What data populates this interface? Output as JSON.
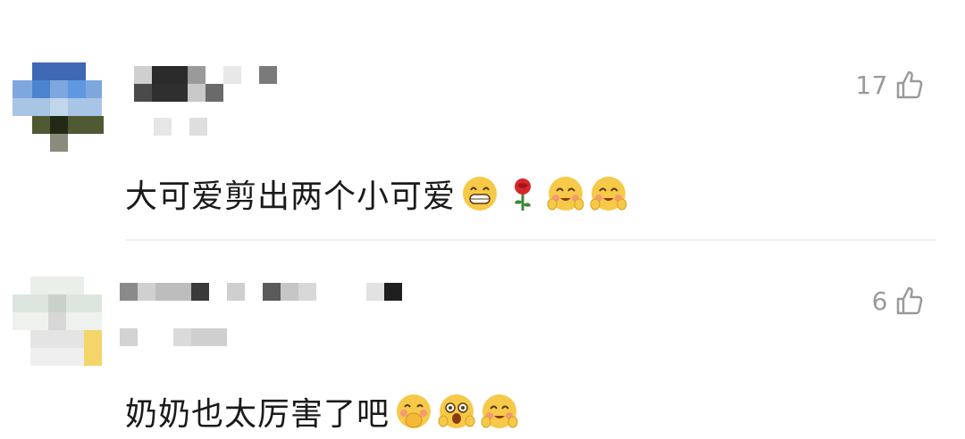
{
  "comments": [
    {
      "likes": "17",
      "text": "大可爱剪出两个小可爱",
      "emojis": [
        "grin-emoji-icon",
        "rose-emoji-icon",
        "happy-emoji-icon",
        "happy-emoji-icon"
      ]
    },
    {
      "likes": "6",
      "text": "奶奶也太厉害了吧",
      "emojis": [
        "hand-cover-mouth-emoji-icon",
        "surprised-emoji-icon",
        "happy-emoji-icon"
      ]
    }
  ],
  "colors": {
    "text": "#1a1a1a",
    "muted": "#9a9a9a",
    "divider": "#f1f1f1"
  }
}
